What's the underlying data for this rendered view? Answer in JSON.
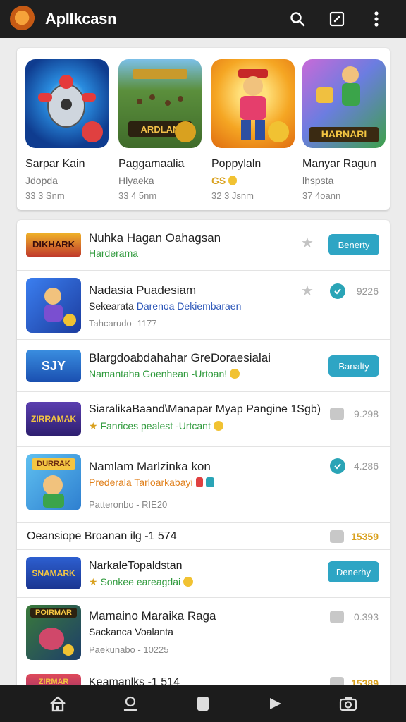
{
  "app": {
    "title": "Apllkcasn"
  },
  "featured": [
    {
      "name": "Sarpar Kain",
      "sub": "Jdopda",
      "meta": "33 3 Snm",
      "sub_color": "#777777"
    },
    {
      "name": "Paggamaalia",
      "sub": "Hlyaeka",
      "meta": "33 4 5nm",
      "sub_color": "#777777"
    },
    {
      "name": "Poppylaln",
      "sub": "GS",
      "meta": "32 3 Jsnm",
      "sub_color": "#d9a11f"
    },
    {
      "name": "Manyar Ragun",
      "sub": "lhspsta",
      "meta": "37 4oann",
      "sub_color": "#777777"
    }
  ],
  "thumb_texts": {
    "f2": "ARDLAN",
    "f4": "HARNARI",
    "l1": "DIKHARK",
    "l3": "SJY",
    "l4": "ZIRRAMAK",
    "l5": "DURRAK",
    "l7": "SNAMARK",
    "l8": "POIRMAR",
    "l10": "ZIRMAR"
  },
  "list": [
    {
      "title": "Nuhka Hagan Oahagsan",
      "sub": "Harderama",
      "action": "Benerty"
    },
    {
      "title": "Nadasia Puadesiam",
      "sub_a": "Sekearata",
      "sub_b": "Darenoa Dekiembaraen",
      "meta": "Tahcarudo- 1177",
      "value": "9226"
    },
    {
      "title": "Blargdoabdahahar GreDoraesialai",
      "sub": "Namantaha Goenhean -Urtoan!",
      "action": "Banalty"
    },
    {
      "title": "SiaralikaBaand\\Manapar Myap Pangine 1Sgb)",
      "sub": "Fanrices pealest -Urtcant",
      "value": "9.298"
    },
    {
      "title": "Namlam Marlzinka kon",
      "sub": "Prederala Tarloarkabayi",
      "meta": "Patteronbo - RIE20",
      "value": "4.286"
    },
    {
      "title": "Oeansiope Broanan ilg -1 574",
      "value": "15359"
    },
    {
      "title": "NarkaleTopaldstan",
      "sub": "Sonkee eareagdai",
      "action": "Denerhy"
    },
    {
      "title": "Mamaino Maraika Raga",
      "sub": "Sackanca Voalanta",
      "meta": "Paekunabo - 10225",
      "value": "0.393"
    },
    {
      "title": "Keamanlks -1 514",
      "value": "15389"
    }
  ],
  "colors": {
    "accent": "#2ea5c4",
    "green_text": "#2f9a3c",
    "blue_text": "#2a55b8",
    "orange_text": "#e0801c",
    "gold": "#d9a11f",
    "appbar": "#1f1f1f"
  },
  "icons": {
    "appbar": [
      "search-icon",
      "edit-icon",
      "more-vert-icon"
    ],
    "nav": [
      "home-icon",
      "profile-icon",
      "library-icon",
      "play-icon",
      "camera-icon"
    ]
  }
}
